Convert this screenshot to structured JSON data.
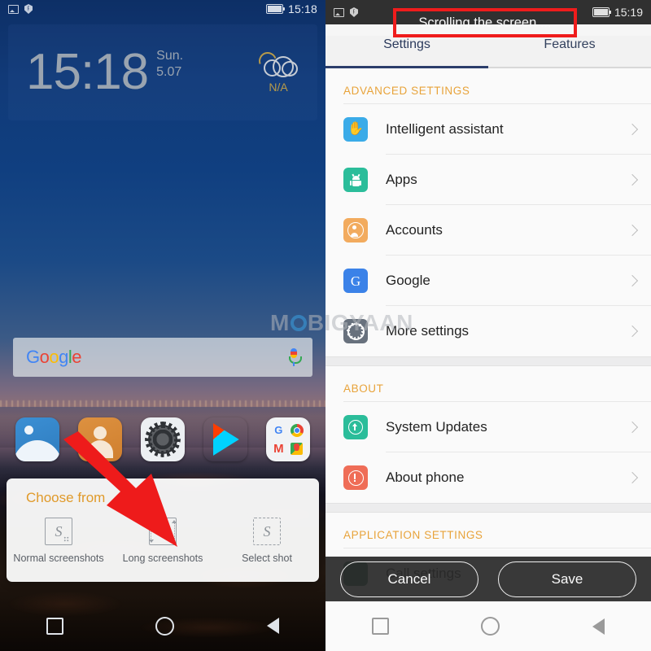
{
  "left_phone": {
    "status_bar": {
      "icons": [
        "image-icon",
        "shield-icon",
        "battery-icon"
      ],
      "time": "15:18"
    },
    "clock_widget": {
      "time": "15:18",
      "day": "Sun.",
      "date": "5.07",
      "weather_icon": "moon-cloud-icon",
      "weather_value": "N/A"
    },
    "search_bar": {
      "logo_letters": [
        "G",
        "o",
        "o",
        "g",
        "l",
        "e"
      ],
      "mic_icon": "microphone-icon"
    },
    "dock": {
      "apps": [
        {
          "name": "gallery-app-icon"
        },
        {
          "name": "contacts-app-icon"
        },
        {
          "name": "settings-app-icon"
        },
        {
          "name": "play-store-app-icon"
        },
        {
          "name": "google-folder-icon",
          "items": [
            "G",
            "chrome-icon",
            "M",
            "maps-icon"
          ]
        }
      ]
    },
    "bottom_sheet": {
      "title": "Choose from",
      "options": [
        {
          "icon": "normal-screenshot-icon",
          "label": "Normal screenshots"
        },
        {
          "icon": "long-screenshot-icon",
          "label": "Long screenshots"
        },
        {
          "icon": "select-shot-icon",
          "label": "Select shot"
        }
      ]
    },
    "nav_bar": {
      "recent": "recents-icon",
      "home": "home-icon",
      "back": "back-icon"
    },
    "annotation": {
      "arrow_color": "#ee1b1b",
      "points_to": "Long screenshots"
    }
  },
  "right_phone": {
    "status_bar": {
      "icons": [
        "image-icon",
        "shield-icon",
        "battery-icon"
      ],
      "time": "15:19"
    },
    "toast": {
      "text": "Scrolling the screen ...",
      "highlight_color": "#ef1c1c"
    },
    "tabs": [
      {
        "label": "Settings",
        "active": true
      },
      {
        "label": "Features",
        "active": false
      }
    ],
    "sections": [
      {
        "header": "ADVANCED SETTINGS",
        "rows": [
          {
            "icon": "hand-icon",
            "icon_color": "#3aabe8",
            "label": "Intelligent assistant"
          },
          {
            "icon": "android-icon",
            "icon_color": "#2bbd9a",
            "label": "Apps"
          },
          {
            "icon": "account-icon",
            "icon_color": "#f2ab5e",
            "label": "Accounts"
          },
          {
            "icon": "google-icon",
            "icon_color": "#3b82e8",
            "label": "Google"
          },
          {
            "icon": "gear-icon",
            "icon_color": "#68717d",
            "label": "More settings"
          }
        ]
      },
      {
        "header": "ABOUT",
        "rows": [
          {
            "icon": "up-arrow-icon",
            "icon_color": "#2bbd9a",
            "label": "System Updates"
          },
          {
            "icon": "exclamation-icon",
            "icon_color": "#ef6d57",
            "label": "About phone"
          }
        ]
      },
      {
        "header": "APPLICATION SETTINGS",
        "rows": [
          {
            "icon": "phone-icon",
            "icon_color": "#1d6b4f",
            "label": "Call settings"
          }
        ]
      }
    ],
    "action_bar": {
      "cancel_label": "Cancel",
      "save_label": "Save"
    },
    "nav_bar": {
      "recent": "recents-icon",
      "home": "home-icon",
      "back": "back-icon"
    }
  },
  "watermark": {
    "text_before": "M",
    "text_after": "BIGYAAN"
  }
}
